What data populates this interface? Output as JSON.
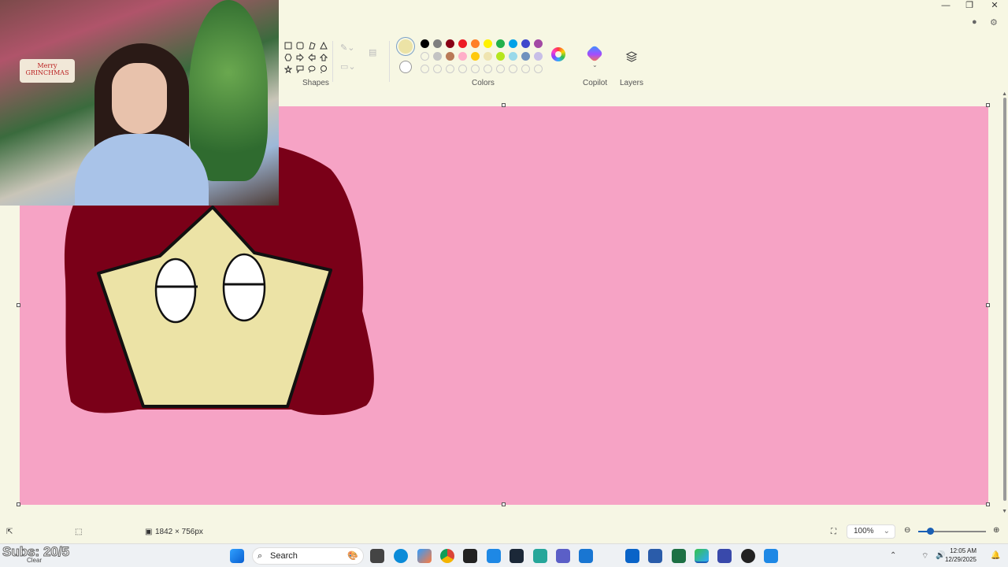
{
  "window": {
    "controls": [
      "—",
      "❐",
      "✕"
    ]
  },
  "ribbon": {
    "shapes_label": "Shapes",
    "colors_label": "Colors",
    "copilot_label": "Copilot",
    "layers_label": "Layers",
    "current_color": "#ece3a6",
    "palette_row1": [
      "#000000",
      "#7f7f7f",
      "#880015",
      "#ed1c24",
      "#ff7f27",
      "#fff200",
      "#22b14c",
      "#00a2e8",
      "#3f48cc",
      "#a349a4"
    ],
    "palette_row2": [
      "",
      "#c3c3c3",
      "#b97a57",
      "#ffaec9",
      "#ffc90e",
      "#efe4b0",
      "#b5e61d",
      "#99d9ea",
      "#7092be",
      "#c8bfe7"
    ],
    "palette_row3_empty": 10
  },
  "canvas": {
    "background": "#f6a3c5",
    "hair_color": "#7a0018",
    "face_color": "#ece3a6"
  },
  "webcam": {
    "sign_text_1": "Merry",
    "sign_text_2": "GRINCHMAS"
  },
  "status": {
    "canvas_size": "1842 × 756px",
    "zoom": "100%",
    "zoom_fraction": 0.18
  },
  "taskbar": {
    "overlay_subs": "Subs: 20/5",
    "weather": "Clear",
    "search_placeholder": "Search",
    "time": "12:05 AM",
    "date": "12/29/2025"
  }
}
